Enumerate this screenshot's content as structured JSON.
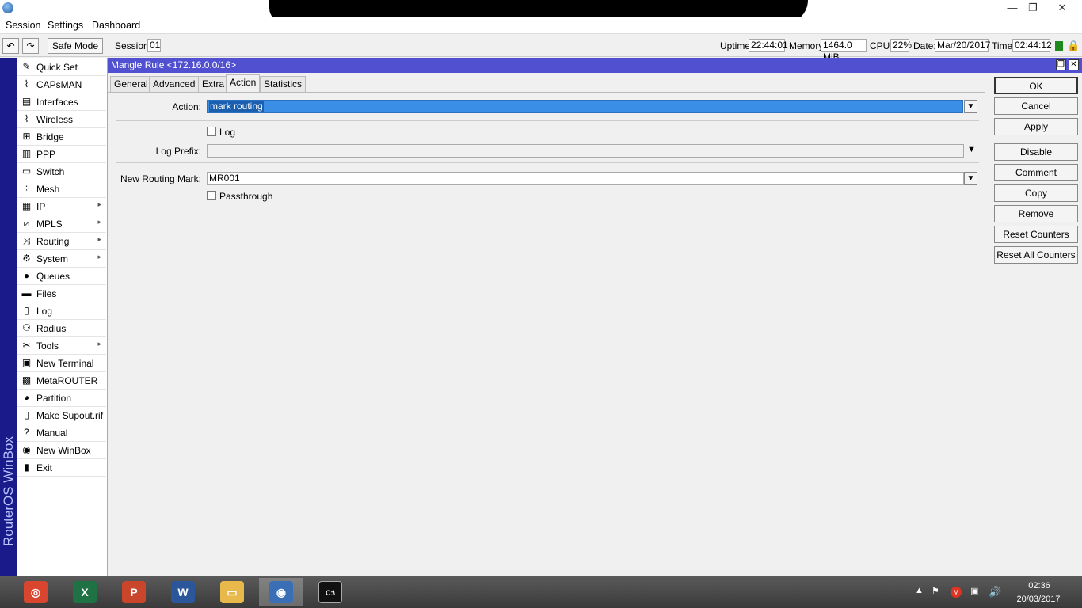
{
  "window": {
    "minimize": "—",
    "maximize": "❐",
    "close": "✕"
  },
  "menu": [
    "Session",
    "Settings",
    "Dashboard"
  ],
  "toolbar": {
    "undo": "↶",
    "redo": "↷",
    "safe_mode": "Safe Mode",
    "session_label": "Session:",
    "session_value": "01",
    "uptime_label": "Uptime:",
    "uptime_value": "22:44:01",
    "memory_label": "Memory:",
    "memory_value": "1464.0 MiB",
    "cpu_label": "CPU:",
    "cpu_value": "22%",
    "date_label": "Date:",
    "date_value": "Mar/20/2017",
    "time_label": "Time:",
    "time_value": "02:44:12"
  },
  "brand": "RouterOS WinBox",
  "sidebar": [
    {
      "label": "Quick Set",
      "icon": "quick-set-icon",
      "glyph": "✎",
      "arrow": false
    },
    {
      "label": "CAPsMAN",
      "icon": "capsman-icon",
      "glyph": "⌇",
      "arrow": false
    },
    {
      "label": "Interfaces",
      "icon": "interfaces-icon",
      "glyph": "▤",
      "arrow": false
    },
    {
      "label": "Wireless",
      "icon": "wireless-icon",
      "glyph": "⌇",
      "arrow": false
    },
    {
      "label": "Bridge",
      "icon": "bridge-icon",
      "glyph": "⊞",
      "arrow": false
    },
    {
      "label": "PPP",
      "icon": "ppp-icon",
      "glyph": "▥",
      "arrow": false
    },
    {
      "label": "Switch",
      "icon": "switch-icon",
      "glyph": "▭",
      "arrow": false
    },
    {
      "label": "Mesh",
      "icon": "mesh-icon",
      "glyph": "⁘",
      "arrow": false
    },
    {
      "label": "IP",
      "icon": "ip-icon",
      "glyph": "▦",
      "arrow": true
    },
    {
      "label": "MPLS",
      "icon": "mpls-icon",
      "glyph": "⧄",
      "arrow": true
    },
    {
      "label": "Routing",
      "icon": "routing-icon",
      "glyph": "⤨",
      "arrow": true
    },
    {
      "label": "System",
      "icon": "system-gear-icon",
      "glyph": "⚙",
      "arrow": true
    },
    {
      "label": "Queues",
      "icon": "queues-icon",
      "glyph": "●",
      "arrow": false
    },
    {
      "label": "Files",
      "icon": "files-folder-icon",
      "glyph": "▬",
      "arrow": false
    },
    {
      "label": "Log",
      "icon": "log-icon",
      "glyph": "▯",
      "arrow": false
    },
    {
      "label": "Radius",
      "icon": "radius-icon",
      "glyph": "⚇",
      "arrow": false
    },
    {
      "label": "Tools",
      "icon": "tools-icon",
      "glyph": "✂",
      "arrow": true
    },
    {
      "label": "New Terminal",
      "icon": "terminal-icon",
      "glyph": "▣",
      "arrow": false
    },
    {
      "label": "MetaROUTER",
      "icon": "metarouter-icon",
      "glyph": "▩",
      "arrow": false
    },
    {
      "label": "Partition",
      "icon": "partition-icon",
      "glyph": "◕",
      "arrow": false
    },
    {
      "label": "Make Supout.rif",
      "icon": "supout-icon",
      "glyph": "▯",
      "arrow": false
    },
    {
      "label": "Manual",
      "icon": "manual-help-icon",
      "glyph": "?",
      "arrow": false
    },
    {
      "label": "New WinBox",
      "icon": "winbox-icon",
      "glyph": "◉",
      "arrow": false
    },
    {
      "label": "Exit",
      "icon": "exit-door-icon",
      "glyph": "▮",
      "arrow": false
    }
  ],
  "dialog": {
    "title": "Mangle Rule <172.16.0.0/16>",
    "tabs": [
      "General",
      "Advanced",
      "Extra",
      "Action",
      "Statistics"
    ],
    "active_tab": "Action",
    "action_label": "Action:",
    "action_value": "mark routing",
    "log_label": "Log",
    "log_prefix_label": "Log Prefix:",
    "log_prefix_value": "",
    "routing_mark_label": "New Routing Mark:",
    "routing_mark_value": "MR001",
    "passthrough_label": "Passthrough",
    "buttons": [
      "OK",
      "Cancel",
      "Apply",
      "Disable",
      "Comment",
      "Copy",
      "Remove",
      "Reset Counters",
      "Reset All Counters"
    ]
  },
  "taskbar": {
    "apps": [
      {
        "name": "chrome",
        "glyph": "◎",
        "color": "#d9452f"
      },
      {
        "name": "excel",
        "glyph": "X",
        "color": "#1f7244"
      },
      {
        "name": "powerpoint",
        "glyph": "P",
        "color": "#c9462c"
      },
      {
        "name": "word",
        "glyph": "W",
        "color": "#2b579a"
      },
      {
        "name": "file-explorer",
        "glyph": "▭",
        "color": "#e8b84a"
      },
      {
        "name": "winbox",
        "glyph": "◉",
        "color": "#3a6fb5"
      },
      {
        "name": "cmd",
        "glyph": "C:\\",
        "color": "#111111"
      }
    ],
    "time": "02:36",
    "date": "20/03/2017"
  }
}
